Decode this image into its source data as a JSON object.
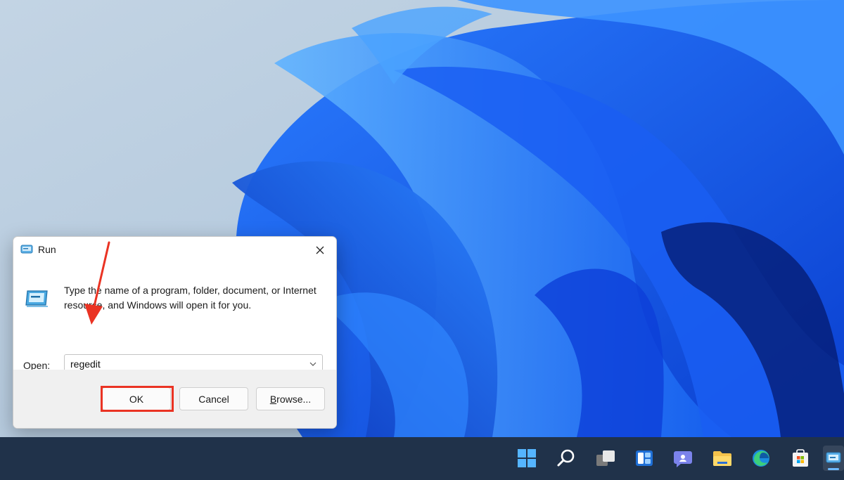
{
  "desktop": {
    "wallpaper": "windows-11-bloom"
  },
  "run_dialog": {
    "title": "Run",
    "title_icon": "run-icon",
    "close_icon": "close-icon",
    "description": "Type the name of a program, folder, document, or Internet resource, and Windows will open it for you.",
    "open_label_mnemonic": "O",
    "open_label_rest": "pen:",
    "open_value": "regedit",
    "buttons": {
      "ok": "OK",
      "cancel": "Cancel",
      "browse_mnemonic": "B",
      "browse_rest": "rowse..."
    }
  },
  "annotations": {
    "highlight_color": "#ea3323"
  },
  "taskbar": {
    "icons": [
      "windows-start-icon",
      "search-icon",
      "task-view-icon",
      "widgets-icon",
      "chat-icon",
      "file-explorer-icon",
      "edge-icon",
      "store-icon",
      "run-app-icon"
    ],
    "accent": "#20324a"
  }
}
